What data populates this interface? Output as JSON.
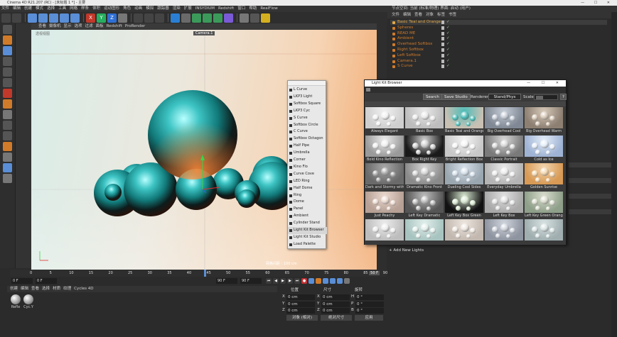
{
  "app": {
    "title": "Cinema 4D R21.207 (RC) - [未标题 1 *] - 主要",
    "window_controls": "—  ☐  ✕"
  },
  "menubar": [
    "文件",
    "编辑",
    "创建",
    "模式",
    "选择",
    "工具",
    "网格",
    "样条",
    "体积",
    "运动图形",
    "角色",
    "动画",
    "模拟",
    "跟踪器",
    "渲染",
    "扩展",
    "INSYDIUM",
    "Redshift",
    "窗口",
    "帮助",
    "RealFlow"
  ],
  "toolbar": {
    "buttons": [
      "undo",
      "redo",
      "select",
      "move",
      "scale",
      "rotate",
      "recent",
      "x-axis",
      "y-axis",
      "z-axis",
      "coord",
      "render-view",
      "render",
      "render-settings",
      "cube",
      "pen",
      "subdivision",
      "array",
      "cloner",
      "deformer",
      "floor",
      "camera",
      "light"
    ],
    "axes": [
      "X",
      "Y",
      "Z"
    ]
  },
  "left_toolbar_icons": [
    "make-editable",
    "model",
    "texture",
    "points",
    "edges",
    "polygons",
    "axis",
    "snap",
    "tweak",
    "workplane",
    "lock",
    "solo",
    "paint",
    "brush",
    "sculpt"
  ],
  "viewport": {
    "menu": [
      "查看",
      "摄像机",
      "显示",
      "选项",
      "过滤",
      "面板",
      "Redshift",
      "ProRender"
    ],
    "label": "透视视图",
    "camera_label": "Camera.1",
    "grid_label": "网格间距 : 100 cm"
  },
  "timeline": {
    "ticks": [
      "0",
      "5",
      "10",
      "15",
      "20",
      "25",
      "30",
      "35",
      "40",
      "45",
      "50",
      "55",
      "60",
      "65",
      "70",
      "75",
      "80",
      "85",
      "90"
    ],
    "current": "50",
    "end_frame": "50 F"
  },
  "transport": {
    "start": "0 F",
    "current": "0 F",
    "end": "90 F",
    "max": "90 F"
  },
  "material_manager": {
    "menu": [
      "创建",
      "编辑",
      "查看",
      "选择",
      "材质",
      "纹理",
      "Cycles 4D"
    ],
    "materials": [
      "Refle",
      "Cyc.Y"
    ]
  },
  "coordinates": {
    "headers": [
      "位置",
      "尺寸",
      "旋转"
    ],
    "rows": [
      {
        "axis": "X",
        "pos": "0 cm",
        "size": "0 cm",
        "rot_label": "H",
        "rot": "0 °"
      },
      {
        "axis": "Y",
        "pos": "0 cm",
        "size": "0 cm",
        "rot_label": "P",
        "rot": "0 °"
      },
      {
        "axis": "Z",
        "pos": "0 cm",
        "size": "0 cm",
        "rot_label": "B",
        "rot": "0 °"
      }
    ],
    "mode_select": "对象 (相对)",
    "size_select": "绝对尺寸",
    "apply_button": "应用"
  },
  "object_manager": {
    "top": "节点空间:  当前 (标准/物理)          界面: 启动 (用户)",
    "menu": [
      "文件",
      "编辑",
      "查看",
      "对象",
      "标签",
      "书签"
    ],
    "objects": [
      {
        "name": "Basic Teal and Orange",
        "color": "#e0a94a"
      },
      {
        "name": "Spheres",
        "color": "#d07b2a"
      },
      {
        "name": "READ ME",
        "color": "#d07b2a"
      },
      {
        "name": "Ambient",
        "color": "#d07b2a"
      },
      {
        "name": "Overhead Softbox",
        "color": "#d07b2a"
      },
      {
        "name": "Right Softbox",
        "color": "#d07b2a"
      },
      {
        "name": "Left Softbox",
        "color": "#d07b2a"
      },
      {
        "name": "Camera.1",
        "color": "#d07b2a"
      },
      {
        "name": "S Curve",
        "color": "#d07b2a"
      }
    ],
    "add_lights": "+ Add New Lights"
  },
  "popup_menu": {
    "items": [
      "L Curve",
      "LKP3 Light",
      "Softbox Square",
      "LKP3 Cyc",
      "S Curve",
      "Softbox Circle",
      "C Curve",
      "Softbox Octagon",
      "Half Pipe",
      "Umbrella",
      "Corner",
      "Kino Flo",
      "Curve Cove",
      "LED Ring",
      "Half Dome",
      "Ring",
      "Dome",
      "Panel",
      "Ambient",
      "Cylinder Stand",
      "Light Kit Browser",
      "Light Kit Studio",
      "Load Palette"
    ]
  },
  "light_kit_browser": {
    "title": "Light Kit Browser",
    "window_controls": "—  ☐  ✕",
    "search_button": "Search",
    "save_button": "Save Studio",
    "renderer_label": "Renderer",
    "renderer_value": "Stand/Phys",
    "scale_label": "Scale",
    "help_button": "?",
    "presets": [
      {
        "label": "Always Elegant",
        "bg": "#cfcfcf",
        "ball": "#f0f0f0"
      },
      {
        "label": "Basic Box",
        "bg": "#bdbdbd",
        "ball": "#e8e8e8"
      },
      {
        "label": "Basic Teal and Orange",
        "bg": "#c9c0b4",
        "ball": "#4dbdb8"
      },
      {
        "label": "Big Overhead Cool",
        "bg": "#7f8894",
        "ball": "#c5ccd6"
      },
      {
        "label": "Big Overhead Warm",
        "bg": "#8d8073",
        "ball": "#d7c9b9"
      },
      {
        "label": "Bold Kino Reflection",
        "bg": "#9a9a9a",
        "ball": "#eeeeee"
      },
      {
        "label": "Box Right Key",
        "bg": "#1a1a1a",
        "ball": "#cfcfcf"
      },
      {
        "label": "Bright Reflection Box",
        "bg": "#c8c8c8",
        "ball": "#f4f4f4"
      },
      {
        "label": "Classic Portrait",
        "bg": "#7a7a7a",
        "ball": "#d8d8d8"
      },
      {
        "label": "Cold as Ice",
        "bg": "#9fb3d4",
        "ball": "#e4edf8"
      },
      {
        "label": "Dark and Stormy with",
        "bg": "#6a6a6a",
        "ball": "#a8a8a8"
      },
      {
        "label": "Dramatic Kino Front",
        "bg": "#8a8a8a",
        "ball": "#d4d4d4"
      },
      {
        "label": "Dueling Cool Sides",
        "bg": "#9aa6b0",
        "ball": "#d6e0ea"
      },
      {
        "label": "Everyday Umbrella",
        "bg": "#b4b4b4",
        "ball": "#ebebeb"
      },
      {
        "label": "Golden Sunrise",
        "bg": "#d89a55",
        "ball": "#f2d6b0"
      },
      {
        "label": "Just Peachy",
        "bg": "#b7a095",
        "ball": "#ead9cf"
      },
      {
        "label": "Left  Key Dramatic",
        "bg": "#555555",
        "ball": "#bdbdbd"
      },
      {
        "label": "Left Key Box Green",
        "bg": "#121212",
        "ball": "#d8e8d0"
      },
      {
        "label": "Left Key Box",
        "bg": "#a9a9a9",
        "ball": "#e0e0e0"
      },
      {
        "label": "Left Key Green Orange",
        "bg": "#8fa08a",
        "ball": "#d9dccd"
      },
      {
        "label": "",
        "bg": "#bdbdbd",
        "ball": "#ececec"
      },
      {
        "label": "",
        "bg": "#a8c4c0",
        "ball": "#e2efec"
      },
      {
        "label": "",
        "bg": "#c2b8b0",
        "ball": "#ede6df"
      },
      {
        "label": "",
        "bg": "#8e94a0",
        "ball": "#cfd4dc"
      },
      {
        "label": "",
        "bg": "#a0aeb0",
        "ball": "#d8e2e2"
      }
    ]
  }
}
